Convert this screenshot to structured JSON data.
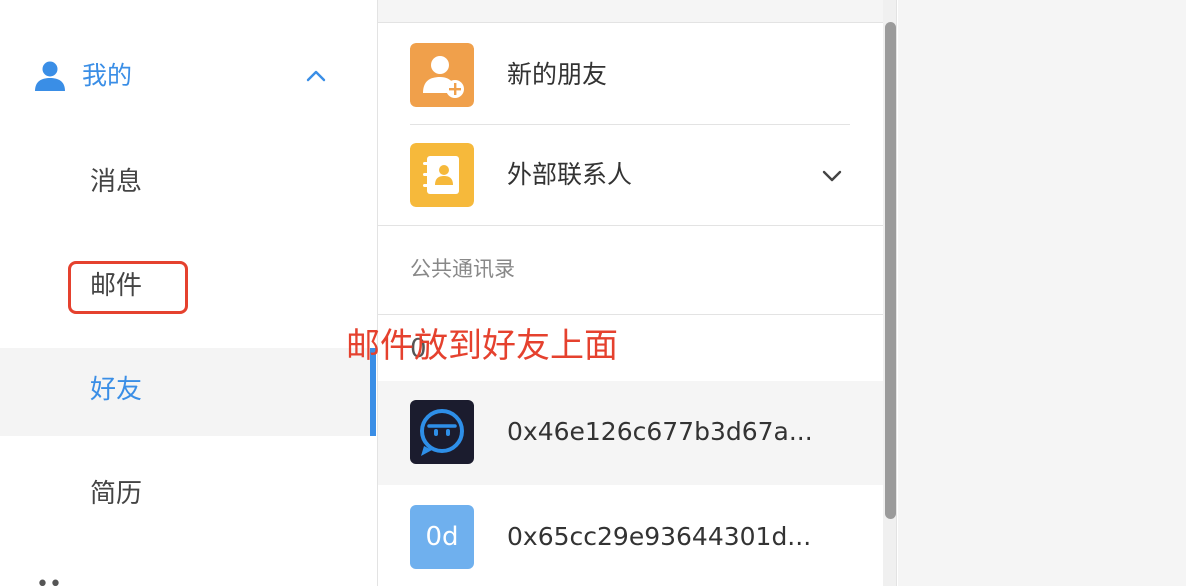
{
  "sidebar": {
    "section": {
      "title": "我的",
      "icon": "user-icon",
      "expanded": true
    },
    "items": [
      {
        "label": "消息"
      },
      {
        "label": "邮件"
      },
      {
        "label": "好友",
        "active": true
      },
      {
        "label": "简历"
      }
    ],
    "accent_color": "#3a8ee6"
  },
  "contacts": {
    "top_items": [
      {
        "label": "新的朋友",
        "icon": "add-friend-icon",
        "color": "#f0a04b"
      },
      {
        "label": "外部联系人",
        "icon": "address-book-icon",
        "color": "#f6b93b",
        "expandable": true
      }
    ],
    "section_label": "公共通讯录",
    "group_letter": "0",
    "entries": [
      {
        "name": "0x46e126c677b3d67a...",
        "avatar": "robot-chat-avatar",
        "selected": true
      },
      {
        "name": "0x65cc29e93644301d...",
        "avatar_text": "0d",
        "avatar_color": "#6fb0ee"
      }
    ]
  },
  "annotation": {
    "text": "邮件放到好友上面",
    "color": "#e5412e"
  }
}
